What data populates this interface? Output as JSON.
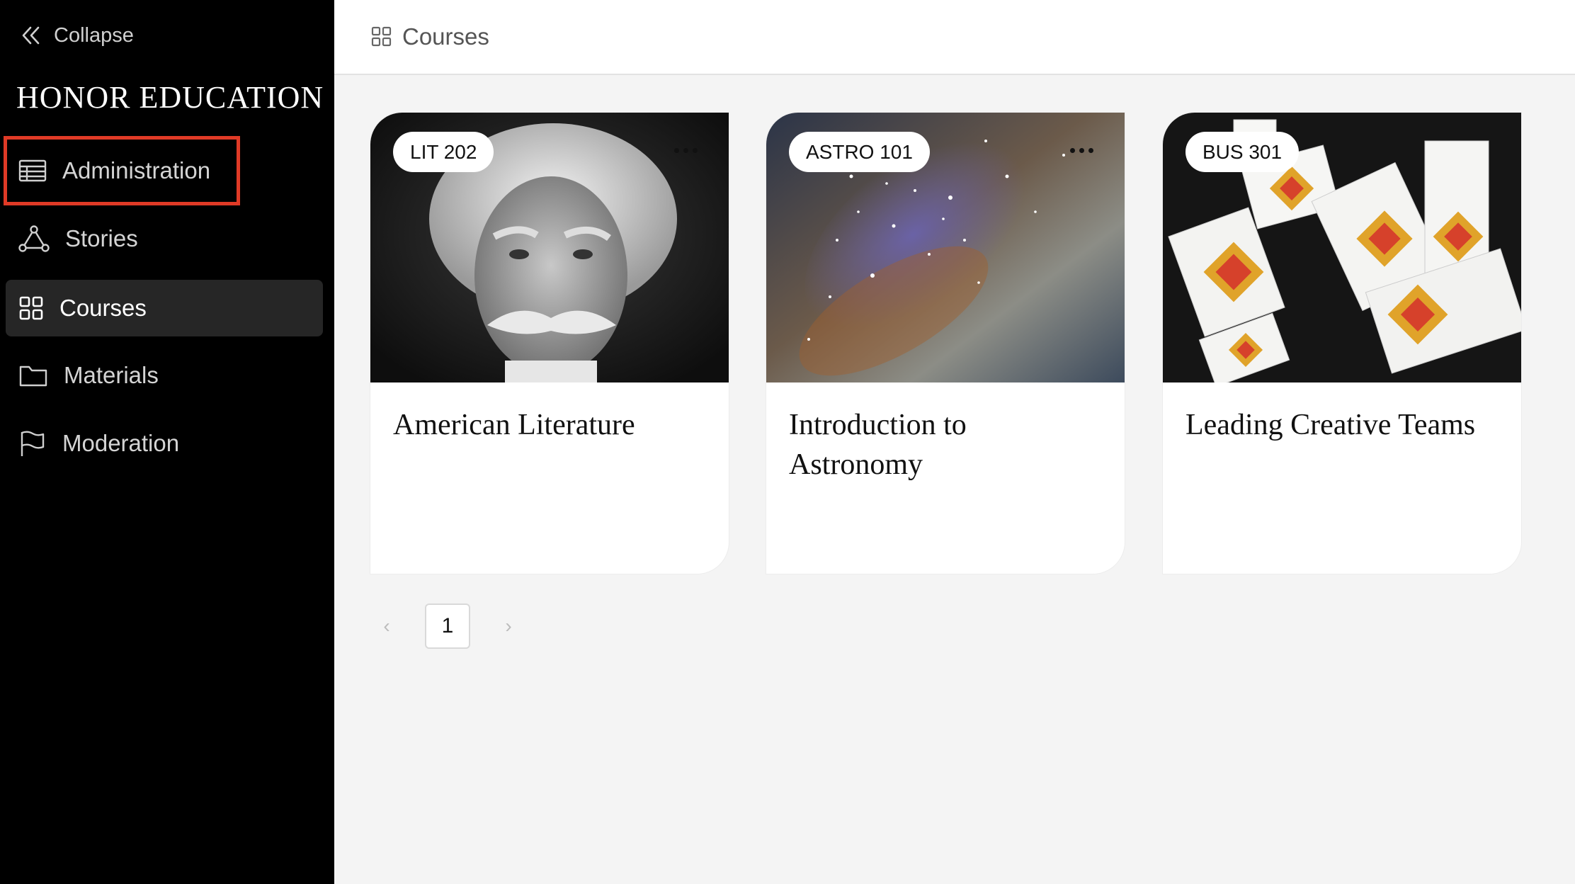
{
  "sidebar": {
    "collapse_label": "Collapse",
    "brand": "HONOR EDUCATION",
    "items": [
      {
        "label": "Administration",
        "icon": "table-icon"
      },
      {
        "label": "Stories",
        "icon": "network-icon"
      },
      {
        "label": "Courses",
        "icon": "grid-icon"
      },
      {
        "label": "Materials",
        "icon": "folder-icon"
      },
      {
        "label": "Moderation",
        "icon": "flag-icon"
      }
    ],
    "active_item": "Courses",
    "highlighted_item": "Administration"
  },
  "header": {
    "title": "Courses",
    "icon": "grid-icon"
  },
  "courses": [
    {
      "code": "LIT 202",
      "title": "American Literature",
      "image": "portrait of author with white hair and mustache"
    },
    {
      "code": "ASTRO 101",
      "title": "Introduction to Astronomy",
      "image": "milky way starfield"
    },
    {
      "code": "BUS 301",
      "title": "Leading Creative Teams",
      "image": "white boxes with colorful diamond patterns"
    }
  ],
  "pagination": {
    "prev": "‹",
    "current": "1",
    "next": "›"
  },
  "colors": {
    "sidebar_bg": "#000000",
    "active_bg": "#262626",
    "highlight": "#e03a26",
    "content_bg": "#f4f4f4"
  }
}
